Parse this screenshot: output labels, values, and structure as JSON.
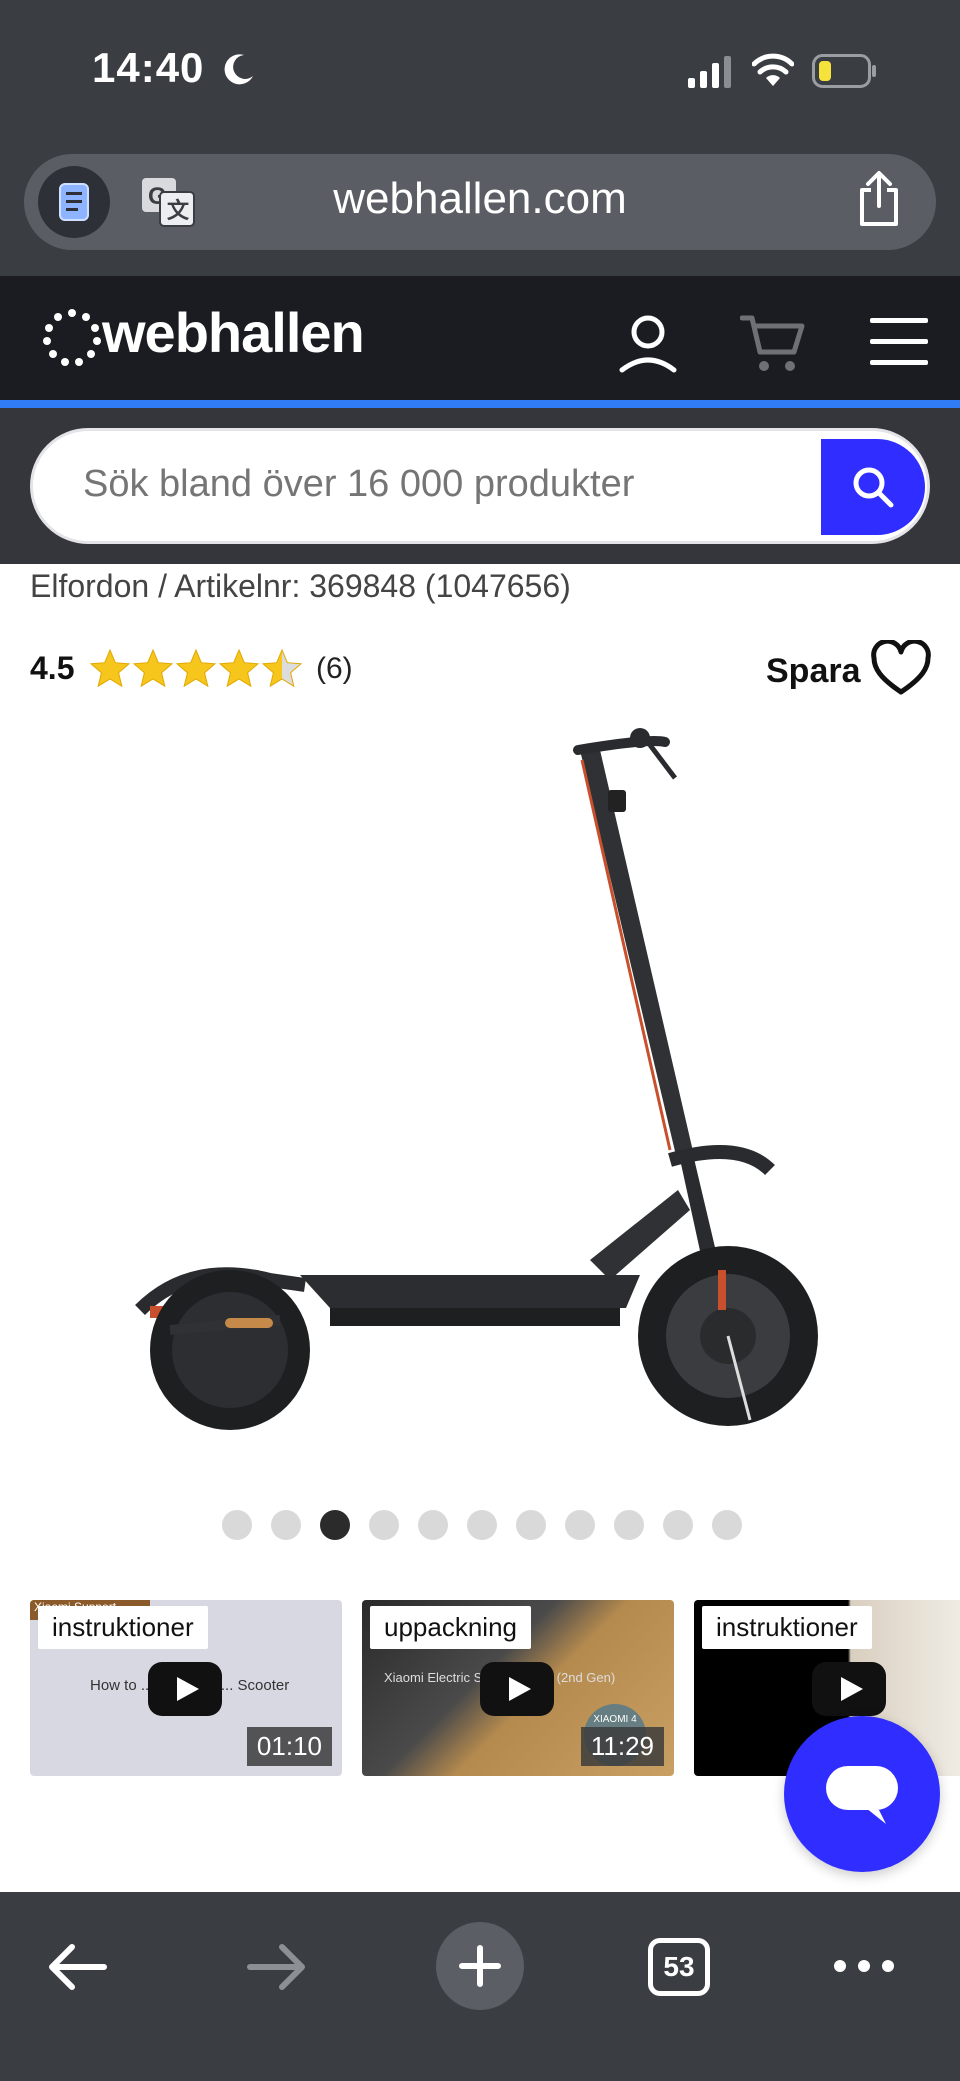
{
  "status_bar": {
    "time": "14:40"
  },
  "browser": {
    "url": "webhallen.com"
  },
  "site": {
    "logo_text": "webhallen",
    "search_placeholder": "Sök bland över 16 000 produkter"
  },
  "product": {
    "breadcrumb": "Elfordon / Artikelnr: 369848 (1047656)",
    "rating_score": "4.5",
    "rating_value": 4.5,
    "rating_max": 5,
    "rating_count": "(6)",
    "save_label": "Spara",
    "gallery_count": 11,
    "gallery_active_index": 2
  },
  "videos": [
    {
      "tag": "instruktioner",
      "duration": "01:10",
      "caption": "How to ... your Mi E... Scooter",
      "corner": "Xiaomi Support"
    },
    {
      "tag": "uppackning",
      "duration": "11:29",
      "caption": "Xiaomi Electric Scooter 4 Pro (2nd Gen)",
      "badge": "XIAOMI 4"
    },
    {
      "tag": "instruktioner"
    }
  ],
  "toolbar": {
    "tab_count": "53"
  },
  "colors": {
    "brand_blue": "#2f2dff",
    "accent_line": "#2f7cf6",
    "header_bg": "#1b1c21"
  }
}
